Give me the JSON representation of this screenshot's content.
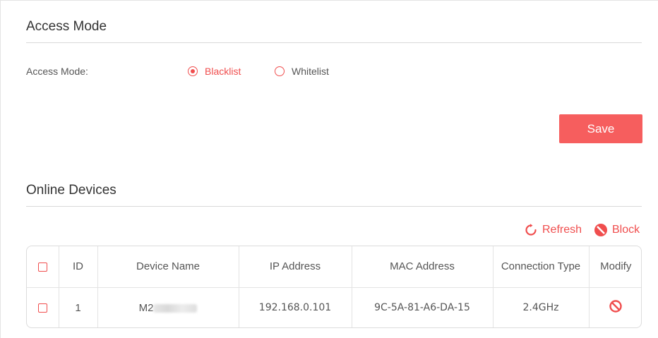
{
  "access_mode_section": {
    "title": "Access Mode",
    "label": "Access Mode:",
    "options": [
      {
        "label": "Blacklist",
        "selected": true
      },
      {
        "label": "Whitelist",
        "selected": false
      }
    ],
    "save_label": "Save"
  },
  "online_devices_section": {
    "title": "Online Devices",
    "refresh_label": "Refresh",
    "block_label": "Block",
    "table": {
      "columns": [
        "ID",
        "Device Name",
        "IP Address",
        "MAC Address",
        "Connection Type",
        "Modify"
      ],
      "rows": [
        {
          "id": "1",
          "device_name": "M2",
          "ip_address": "192.168.0.101",
          "mac_address": "9C-5A-81-A6-DA-15",
          "connection_type": "2.4GHz",
          "modify_icon": "block-icon"
        }
      ]
    }
  },
  "colors": {
    "accent": "#f04e4e",
    "button": "#f65e5e"
  }
}
